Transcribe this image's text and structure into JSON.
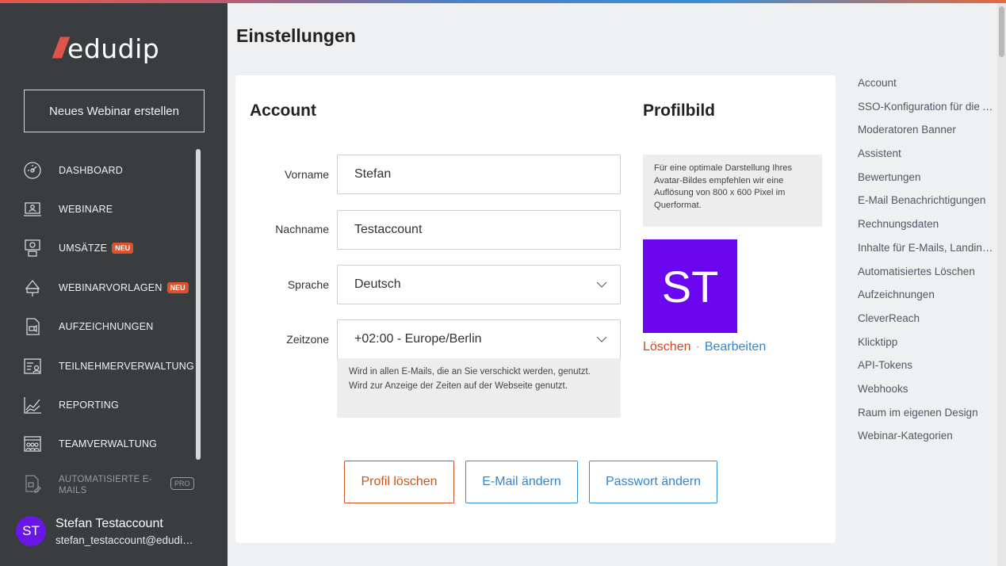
{
  "app": {
    "logo_text": "edudip"
  },
  "sidebar": {
    "new_webinar_label": "Neues Webinar erstellen",
    "items": [
      {
        "label": "DASHBOARD",
        "icon": "dashboard-gauge-icon"
      },
      {
        "label": "WEBINARE",
        "icon": "webinar-icon"
      },
      {
        "label": "UMSÄTZE",
        "icon": "revenue-icon",
        "badge": "NEU"
      },
      {
        "label": "WEBINARVORLAGEN",
        "icon": "template-icon",
        "badge": "NEU"
      },
      {
        "label": "AUFZEICHNUNGEN",
        "icon": "recording-icon"
      },
      {
        "label": "TEILNEHMERVERWALTUNG",
        "icon": "participants-icon"
      },
      {
        "label": "REPORTING",
        "icon": "reporting-icon"
      },
      {
        "label": "TEAMVERWALTUNG",
        "icon": "team-icon"
      },
      {
        "label": "AUTOMATISIERTE E-MAILS",
        "icon": "email-automation-icon",
        "badge": "PRO"
      }
    ],
    "user": {
      "initials": "ST",
      "name": "Stefan Testaccount",
      "email": "stefan_testaccount@edudip.com"
    }
  },
  "main": {
    "page_title": "Einstellungen",
    "account": {
      "title": "Account",
      "fields": {
        "vorname": {
          "label": "Vorname",
          "value": "Stefan"
        },
        "nachname": {
          "label": "Nachname",
          "value": "Testaccount"
        },
        "sprache": {
          "label": "Sprache",
          "value": "Deutsch"
        },
        "zeitzone": {
          "label": "Zeitzone",
          "value": "+02:00 - Europe/Berlin"
        }
      },
      "timezone_hint": "Wird in allen E-Mails, die an Sie verschickt werden, genutzt. Wird zur Anzeige der Zeiten auf der Webseite genutzt."
    },
    "profile_picture": {
      "title": "Profilbild",
      "hint": "Für eine optimale Darstellung Ihres Avatar-Bildes empfehlen wir eine Auflösung von 800 x 600 Pixel im Querformat.",
      "initials": "ST",
      "delete_label": "Löschen",
      "separator": "·",
      "edit_label": "Bearbeiten"
    },
    "buttons": {
      "delete_profile": "Profil löschen",
      "change_email": "E-Mail ändern",
      "change_password": "Passwort ändern"
    }
  },
  "anchors": [
    "Account",
    "SSO-Konfiguration für die Anmeldung",
    "Moderatoren Banner",
    "Assistent",
    "Bewertungen",
    "E-Mail Benachrichtigungen",
    "Rechnungsdaten",
    "Inhalte für E-Mails, Landingpages",
    "Automatisiertes Löschen",
    "Aufzeichnungen",
    "CleverReach",
    "Klicktipp",
    "API-Tokens",
    "Webhooks",
    "Raum im eigenen Design",
    "Webinar-Kategorien"
  ],
  "colors": {
    "sidebar_bg": "#3a3d3f",
    "accent_purple": "#6a06f0",
    "accent_red": "#c8571f",
    "accent_blue": "#2e86d6",
    "badge_orange": "#e0502a"
  }
}
